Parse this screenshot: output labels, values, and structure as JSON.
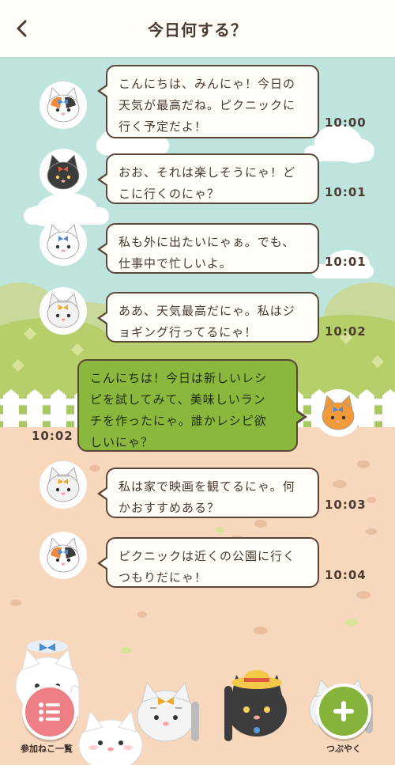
{
  "header": {
    "title": "今日何する？",
    "back_icon": "chevron-left-icon"
  },
  "messages": [
    {
      "cat": "calico",
      "text_lines": [
        "こんにちは、みんにゃ！今日の",
        "天気が最高だね。ピクニックに",
        "行く予定だよ！"
      ],
      "time": "10:00",
      "side": "left"
    },
    {
      "cat": "black",
      "text_lines": [
        "おお、それは楽しそうにゃ！ど",
        "こに行くのにゃ？"
      ],
      "time": "10:01",
      "side": "left"
    },
    {
      "cat": "white",
      "text_lines": [
        "私も外に出たいにゃぁ。でも、",
        "仕事中で忙しいよ。"
      ],
      "time": "10:01",
      "side": "left"
    },
    {
      "cat": "tabby",
      "text_lines": [
        "ああ、天気最高だにゃ。私はジ",
        "ョギング行ってるにゃ！"
      ],
      "time": "10:02",
      "side": "left"
    },
    {
      "cat": "orange",
      "text_lines": [
        "こんにちは！今日は新しいレシ",
        "ピを試してみて、美味しいラン",
        "チを作ったにゃ。誰かレシピ欲",
        "しいにゃ？"
      ],
      "time": "10:02",
      "side": "right"
    },
    {
      "cat": "tabby",
      "text_lines": [
        "私は家で映画を観てるにゃ。何",
        "かおすすめある？"
      ],
      "time": "10:03",
      "side": "left"
    },
    {
      "cat": "calico",
      "text_lines": [
        "ピクニックは近くの公園に行く",
        "つもりだにゃ！"
      ],
      "time": "10:04",
      "side": "left"
    }
  ],
  "footer": {
    "members_label": "参加ねこ一覧",
    "members_icon": "list-icon",
    "post_label": "つぶやく",
    "post_icon": "plus-icon"
  },
  "colors": {
    "sky": "#bfe4de",
    "grass": "#a8c860",
    "ground": "#f7d8bd",
    "bubble_border": "#5a4538",
    "own_bubble": "#8ab83c",
    "members_button": "#ef7f86",
    "post_button": "#86b43a"
  }
}
